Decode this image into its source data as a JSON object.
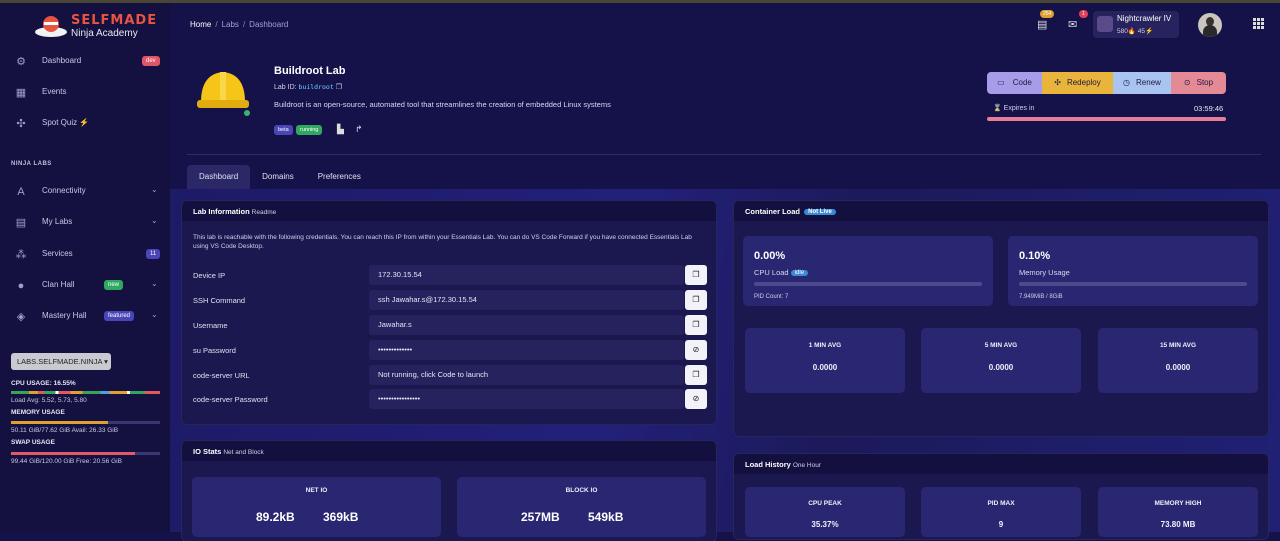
{
  "brand": {
    "name": "SELFMADE",
    "tagline": "Ninja Academy"
  },
  "sidebar": {
    "items": [
      {
        "label": "Dashboard",
        "badge": "dev"
      },
      {
        "label": "Events"
      },
      {
        "label": "Spot Quiz ⚡"
      }
    ],
    "section_title": "NINJA LABS",
    "ninja_items": [
      {
        "label": "Connectivity"
      },
      {
        "label": "My Labs"
      },
      {
        "label": "Services",
        "badge": "11"
      },
      {
        "label": "Clan Hall",
        "badge": "new"
      },
      {
        "label": "Mastery Hall",
        "badge": "featured"
      }
    ],
    "labs_button": "LABS.SELFMADE.NINJA ▾",
    "cpu_label": "CPU USAGE: 16.55%",
    "load_avg": "Load Avg: 5.52, 5.73, 5.80",
    "memory_label": "MEMORY USAGE",
    "memory_detail": "50.11 GiB/77.62 GiB Avail: 26.33 GiB",
    "swap_label": "SWAP USAGE",
    "swap_detail": "99.44 GiB/120.00 GiB Free: 20.56 GiB",
    "memory_fraction": 0.65,
    "swap_fraction": 0.83
  },
  "breadcrumb": {
    "home": "Home",
    "labs": "Labs",
    "current": "Dashboard"
  },
  "header": {
    "notif_count": "254",
    "mail_count": "1",
    "user_name": "Nightcrawler IV",
    "user_stats": "580🔥 45⚡"
  },
  "lab": {
    "title": "Buildroot Lab",
    "id_label": "Lab ID:",
    "id_value": "buildroot",
    "description": "Buildroot is an open-source, automated tool that streamlines the creation of embedded Linux systems",
    "tag_beta": "beta",
    "tag_running": "running"
  },
  "actions": {
    "code": "Code",
    "redeploy": "Redeploy",
    "renew": "Renew",
    "stop": "Stop",
    "expires_label": "⌛ Expires in",
    "timer": "03:59:46"
  },
  "tabs": [
    "Dashboard",
    "Domains",
    "Preferences"
  ],
  "lab_info": {
    "title": "Lab Information",
    "subtitle": "Readme",
    "intro": "This lab is reachable with the following credentials. You can reach this IP from within your Essentials Lab. You can do VS Code Forward if you have connected Essentials Lab using VS Code Desktop.",
    "rows": [
      {
        "label": "Device IP",
        "value": "172.30.15.54"
      },
      {
        "label": "SSH Command",
        "value": "ssh Jawahar.s@172.30.15.54"
      },
      {
        "label": "Username",
        "value": "Jawahar.s"
      },
      {
        "label": "su Password",
        "value": "•••••••••••••"
      },
      {
        "label": "code-server URL",
        "value": "Not running, click Code to launch"
      },
      {
        "label": "code-server Password",
        "value": "••••••••••••••••"
      }
    ]
  },
  "container_load": {
    "title": "Container Load",
    "badge": "Not Live",
    "cpu_value": "0.00%",
    "cpu_label": "CPU Load",
    "cpu_badge": "idle",
    "pid_count": "PID Count: 7",
    "mem_value": "0.10%",
    "mem_label": "Memory Usage",
    "mem_detail": "7.949MiB / 8GiB",
    "averages": [
      {
        "label": "1 MIN AVG",
        "value": "0.0000"
      },
      {
        "label": "5 MIN AVG",
        "value": "0.0000"
      },
      {
        "label": "15 MIN AVG",
        "value": "0.0000"
      }
    ]
  },
  "io_stats": {
    "title": "IO Stats",
    "subtitle": "Net and Block",
    "net_title": "NET IO",
    "net_in": "89.2kB",
    "net_out": "369kB",
    "block_title": "BLOCK IO",
    "block_in": "257MB",
    "block_out": "549kB"
  },
  "load_history": {
    "title": "Load History",
    "subtitle": "One Hour",
    "cards": [
      {
        "label": "CPU PEAK",
        "value": "35.37%"
      },
      {
        "label": "PID MAX",
        "value": "9"
      },
      {
        "label": "MEMORY HIGH",
        "value": "73.80 MB"
      }
    ]
  },
  "colors": {
    "code": "#a69ce8",
    "redeploy": "#e9b43c",
    "renew": "#a9c4f0",
    "stop": "#e48a96",
    "dev_badge": "#e0556a",
    "services_badge": "#4a46b8",
    "new_badge": "#2fa860",
    "featured_badge": "#4a46b8"
  }
}
